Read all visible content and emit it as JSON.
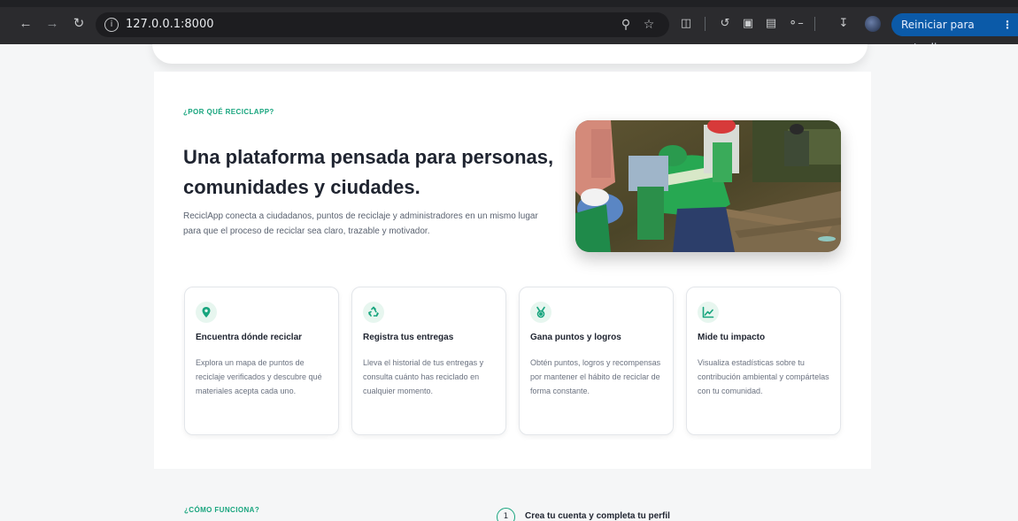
{
  "browser": {
    "url": "127.0.0.1:8000",
    "update_button_label": "Reiniciar para actualizar",
    "icons": [
      "back-icon",
      "forward-icon",
      "reload-icon",
      "site-info-icon",
      "zoom-icon",
      "bookmark-star-icon",
      "extensions-icon",
      "history-icon",
      "screen-capture-icon",
      "media-icon",
      "password-key-icon",
      "download-icon",
      "profile-avatar-icon",
      "menu-kebab-icon"
    ]
  },
  "why": {
    "eyebrow": "¿POR QUÉ RECICLAPP?",
    "title_line1": "Una plataforma pensada para personas,",
    "title_line2": "comunidades y ciudades.",
    "description": "ReciclApp conecta a ciudadanos, puntos de reciclaje y administradores en un mismo lugar para que el proceso de reciclar sea claro, trazable y motivador."
  },
  "features": [
    {
      "icon": "map-pin-icon",
      "title": "Encuentra dónde reciclar",
      "description": "Explora un mapa de puntos de reciclaje verificados y descubre qué materiales acepta cada uno."
    },
    {
      "icon": "recycle-icon",
      "title": "Registra tus entregas",
      "description": "Lleva el historial de tus entregas y consulta cuánto has reciclado en cualquier momento."
    },
    {
      "icon": "medal-icon",
      "title": "Gana puntos y logros",
      "description": "Obtén puntos, logros y recompensas por mantener el hábito de reciclar de forma constante."
    },
    {
      "icon": "chart-line-icon",
      "title": "Mide tu impacto",
      "description": "Visualiza estadísticas sobre tu contribución ambiental y compártelas con tu comunidad."
    }
  ],
  "how": {
    "eyebrow": "¿CÓMO FUNCIONA?",
    "step1_number": "1",
    "step1_title": "Crea tu cuenta y completa tu perfil"
  },
  "colors": {
    "accent": "#18a57e",
    "icon_bg": "#e7f6ef",
    "title_text": "#1f2430",
    "update_button": "#0b5aa8"
  }
}
